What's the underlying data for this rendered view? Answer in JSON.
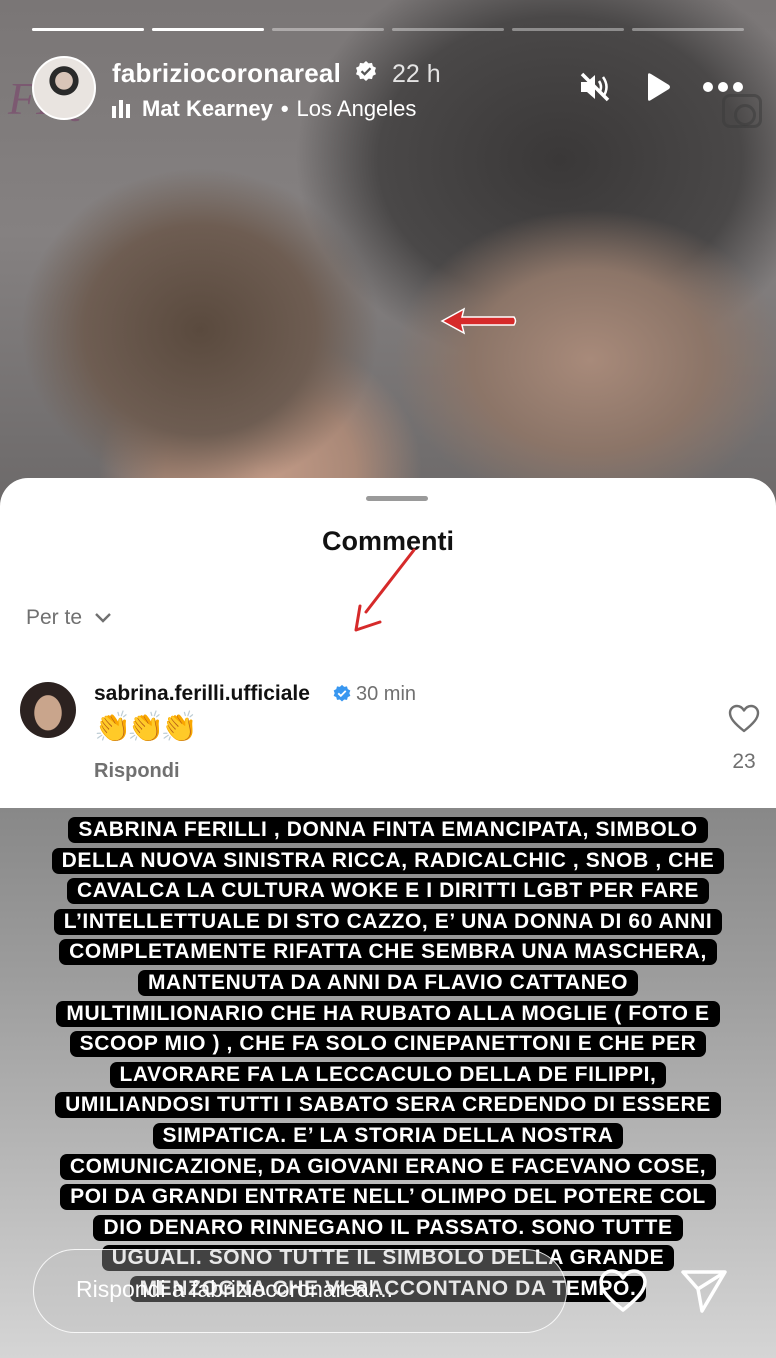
{
  "story": {
    "progress_segments": [
      1,
      1,
      0,
      0,
      0,
      0
    ],
    "header": {
      "username": "fabriziocoronareal",
      "time": "22 h",
      "music_artist": "Mat Kearney",
      "music_separator": "•",
      "location": "Los Angeles"
    },
    "background_logo": "FIQ"
  },
  "comments_sheet": {
    "title": "Commenti",
    "filter_label": "Per te",
    "comment": {
      "username": "sabrina.ferilli.ufficiale",
      "time": "30 min",
      "text": "👏👏👏",
      "reply_label": "Rispondi",
      "like_count": "23"
    }
  },
  "caption_lines": [
    "SABRINA FERILLI , DONNA FINTA EMANCIPATA, SIMBOLO",
    "DELLA NUOVA SINISTRA RICCA, RADICALCHIC , SNOB , CHE",
    "CAVALCA LA CULTURA WOKE E I DIRITTI LGBT PER FARE",
    "L’INTELLETTUALE DI STO CAZZO, E’ UNA DONNA DI 60 ANNI",
    "COMPLETAMENTE RIFATTA CHE SEMBRA UNA MASCHERA,",
    "MANTENUTA DA ANNI DA FLAVIO CATTANEO",
    "MULTIMILIONARIO CHE HA RUBATO ALLA MOGLIE ( FOTO E",
    "SCOOP MIO ) , CHE FA SOLO CINEPANETTONI E CHE PER",
    "LAVORARE FA LA LECCACULO DELLA DE FILIPPI,",
    "UMILIANDOSI TUTTI I SABATO SERA CREDENDO DI ESSERE",
    "SIMPATICA. E’ LA STORIA DELLA NOSTRA",
    "COMUNICAZIONE, DA GIOVANI ERANO E FACEVANO COSE,",
    "POI DA GRANDI ENTRATE NELL’ OLIMPO DEL POTERE COL",
    "DIO DENARO RINNEGANO IL PASSATO. SONO TUTTE",
    "UGUALI. SONO TUTTE  IL SIMBOLO DELLA GRANDE",
    "MENZOGNA CHE VI RACCONTANO DA TEMPO."
  ],
  "reply_bar": {
    "placeholder": "Rispondi a fabriziocoronareal..."
  },
  "icons": {
    "mute": "speaker-muted-icon",
    "play": "play-icon",
    "more": "more-dots-icon",
    "like": "heart-outline-icon",
    "send": "paper-plane-icon"
  },
  "colors": {
    "annotation_arrow": "#d62a2a",
    "verified_badge": "#3897f0"
  }
}
